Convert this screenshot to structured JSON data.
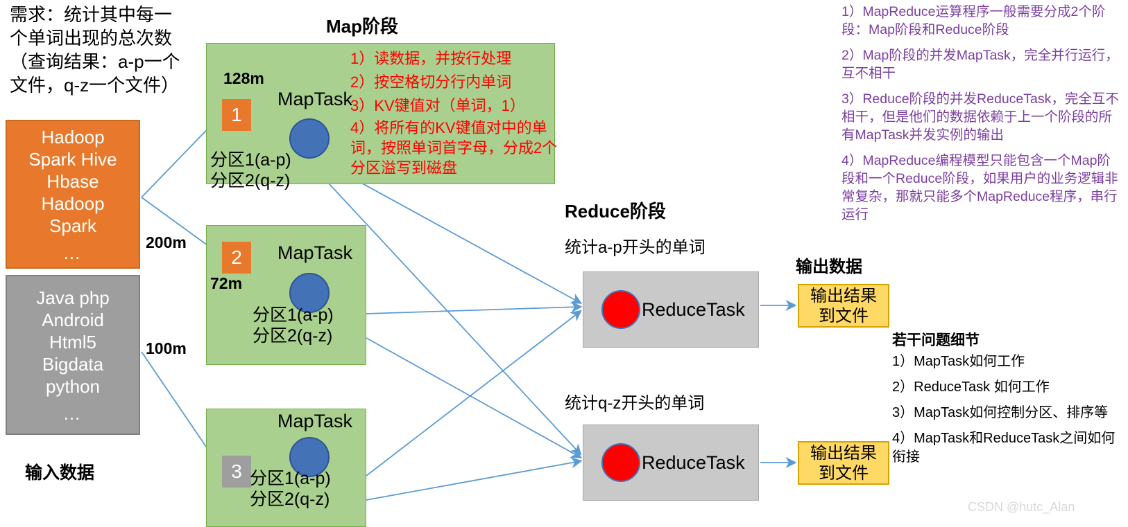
{
  "requirement": "需求：统计其中每一个单词出现的总次数（查询结果：a-p一个文件，q-z一个文件）",
  "input": {
    "label": "输入数据",
    "orange_box": {
      "lines": [
        "Hadoop",
        "Spark Hive",
        "Hbase",
        "Hadoop",
        "Spark"
      ],
      "ellipsis": "…",
      "color": "#E8792C"
    },
    "gray_box": {
      "lines": [
        "Java php",
        "Android",
        "Html5",
        "Bigdata",
        "python"
      ],
      "ellipsis": "…",
      "color": "#9E9E9E"
    },
    "sizes": {
      "orange_total": "200m",
      "gray_total": "100m"
    }
  },
  "map_phase": {
    "title": "Map阶段",
    "box_color": "#A9D08E",
    "boxes": [
      {
        "chunk_number": "1",
        "chunk_color": "#E8792C",
        "size_label": "128m",
        "task_label": "MapTask",
        "partitions": [
          "分区1(a-p)",
          "分区2(q-z)"
        ]
      },
      {
        "chunk_number": "2",
        "chunk_color": "#E8792C",
        "size_label": "72m",
        "task_label": "MapTask",
        "partitions": [
          "分区1(a-p)",
          "分区2(q-z)"
        ]
      },
      {
        "chunk_number": "3",
        "chunk_color": "#9E9E9E",
        "size_label": "",
        "task_label": "MapTask",
        "partitions": [
          "分区1(a-p)",
          "分区2(q-z)"
        ]
      }
    ],
    "steps": [
      "1）读数据，并按行处理",
      "2）按空格切分行内单词",
      "3）KV键值对（单词，1）",
      "4）将所有的KV键值对中的单词，按照单词首字母，分成2个分区溢写到磁盘"
    ],
    "steps_color": "#FF0000"
  },
  "reduce_phase": {
    "title": "Reduce阶段",
    "box_color": "#C9C9C9",
    "tasks": [
      {
        "caption": "统计a-p开头的单词",
        "label": "ReduceTask",
        "circle_color": "#FF0000"
      },
      {
        "caption": "统计q-z开头的单词",
        "label": "ReduceTask",
        "circle_color": "#FF0000"
      }
    ]
  },
  "output": {
    "title": "输出数据",
    "box_color": "#FFD966",
    "boxes": [
      {
        "line1": "输出结果",
        "line2": "到文件"
      },
      {
        "line1": "输出结果",
        "line2": "到文件"
      }
    ]
  },
  "notes": {
    "color": "#7B3FA0",
    "items": [
      "1）MapReduce运算程序一般需要分成2个阶段：Map阶段和Reduce阶段",
      "2）Map阶段的并发MapTask，完全并行运行，互不相干",
      "3）Reduce阶段的并发ReduceTask，完全互不相干，但是他们的数据依赖于上一个阶段的所有MapTask并发实例的输出",
      "4）MapReduce编程模型只能包含一个Map阶段和一个Reduce阶段，如果用户的业务逻辑非常复杂，那就只能多个MapReduce程序，串行运行"
    ]
  },
  "details": {
    "title": "若干问题细节",
    "items": [
      "1）MapTask如何工作",
      "2）ReduceTask 如何工作",
      "3）MapTask如何控制分区、排序等",
      "4）MapTask和ReduceTask之间如何衔接"
    ]
  },
  "watermark": "CSDN @hutc_Alan"
}
